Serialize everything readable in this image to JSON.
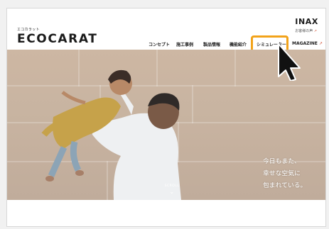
{
  "brand": {
    "kana": "エコカラット",
    "logo": "ECOCARAT",
    "maker": "INAX"
  },
  "utility": {
    "label": "お客様の声",
    "ext_icon": "external-link-icon"
  },
  "nav": {
    "items": [
      {
        "label": "コンセプト"
      },
      {
        "label": "施工事例"
      },
      {
        "label": "製品情報"
      },
      {
        "label": "機能紹介"
      },
      {
        "label": "シミュレーター"
      },
      {
        "label": "MAGAZINE"
      }
    ],
    "highlighted_item": "シミュレーター",
    "highlight_color": "#f2a31a"
  },
  "hero": {
    "copy_lines": [
      "今日もまた、",
      "幸せな空気に",
      "包まれている。"
    ],
    "scroll_label": "SCROLL"
  }
}
